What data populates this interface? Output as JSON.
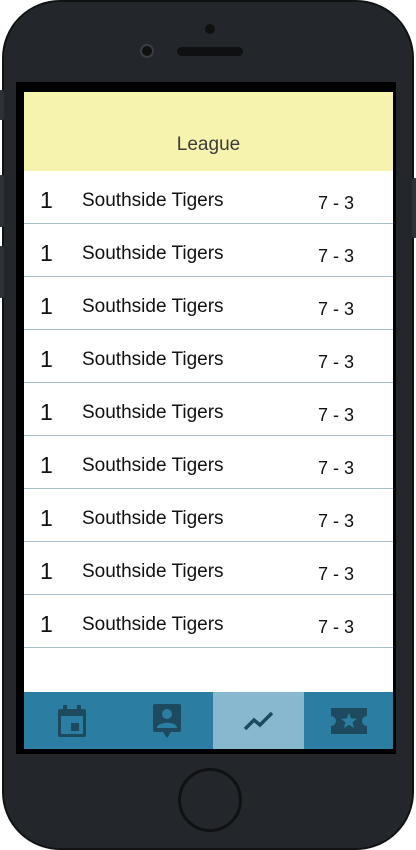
{
  "header": {
    "title": "League"
  },
  "standings": [
    {
      "rank": "1",
      "team": "Southside Tigers",
      "record": "7 - 3"
    },
    {
      "rank": "1",
      "team": "Southside Tigers",
      "record": "7 - 3"
    },
    {
      "rank": "1",
      "team": "Southside Tigers",
      "record": "7 - 3"
    },
    {
      "rank": "1",
      "team": "Southside Tigers",
      "record": "7 - 3"
    },
    {
      "rank": "1",
      "team": "Southside Tigers",
      "record": "7 - 3"
    },
    {
      "rank": "1",
      "team": "Southside Tigers",
      "record": "7 - 3"
    },
    {
      "rank": "1",
      "team": "Southside Tigers",
      "record": "7 - 3"
    },
    {
      "rank": "1",
      "team": "Southside Tigers",
      "record": "7 - 3"
    },
    {
      "rank": "1",
      "team": "Southside Tigers",
      "record": "7 - 3"
    }
  ],
  "tabbar": {
    "tabs": [
      {
        "icon": "calendar-icon",
        "active": false
      },
      {
        "icon": "contact-card-icon",
        "active": false
      },
      {
        "icon": "trending-chart-icon",
        "active": true
      },
      {
        "icon": "ticket-star-icon",
        "active": false
      }
    ]
  },
  "colors": {
    "header_bg": "#f5f3ad",
    "tabbar_bg": "#2b7ea2",
    "tab_active_bg": "#87b8cf",
    "icon_color": "#1d4a5e",
    "row_divider": "#a9bfc9"
  }
}
